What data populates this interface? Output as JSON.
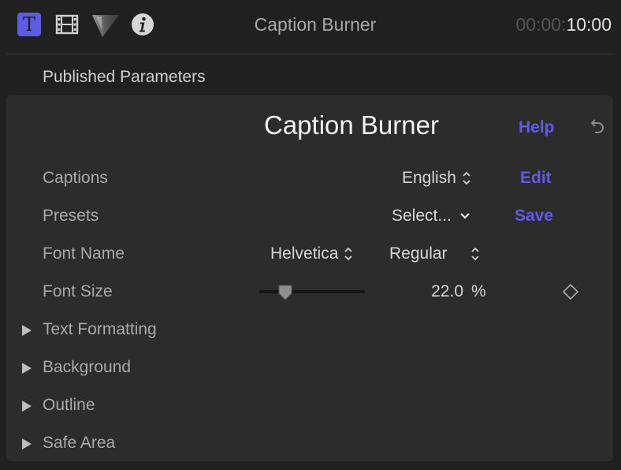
{
  "toolbar": {
    "title": "Caption Burner",
    "timecode_dim": "00:00:",
    "timecode_bright": "10:00",
    "icons": [
      "text-inspector-icon",
      "video-inspector-icon",
      "color-inspector-icon",
      "info-inspector-icon"
    ],
    "text_icon_glyph": "T",
    "active_color": "#5e5ce6"
  },
  "section": {
    "heading": "Published Parameters"
  },
  "panel": {
    "title": "Caption Burner",
    "help_label": "Help",
    "reset_icon": "reset-icon"
  },
  "params": {
    "captions": {
      "label": "Captions",
      "value": "English",
      "action": "Edit"
    },
    "presets": {
      "label": "Presets",
      "value": "Select...",
      "action": "Save"
    },
    "font_name": {
      "label": "Font Name",
      "family": "Helvetica",
      "style": "Regular"
    },
    "font_size": {
      "label": "Font Size",
      "value": "22.0",
      "unit": "%",
      "slider_fraction": 0.22
    }
  },
  "groups": [
    {
      "label": "Text Formatting"
    },
    {
      "label": "Background"
    },
    {
      "label": "Outline"
    },
    {
      "label": "Safe Area"
    }
  ]
}
